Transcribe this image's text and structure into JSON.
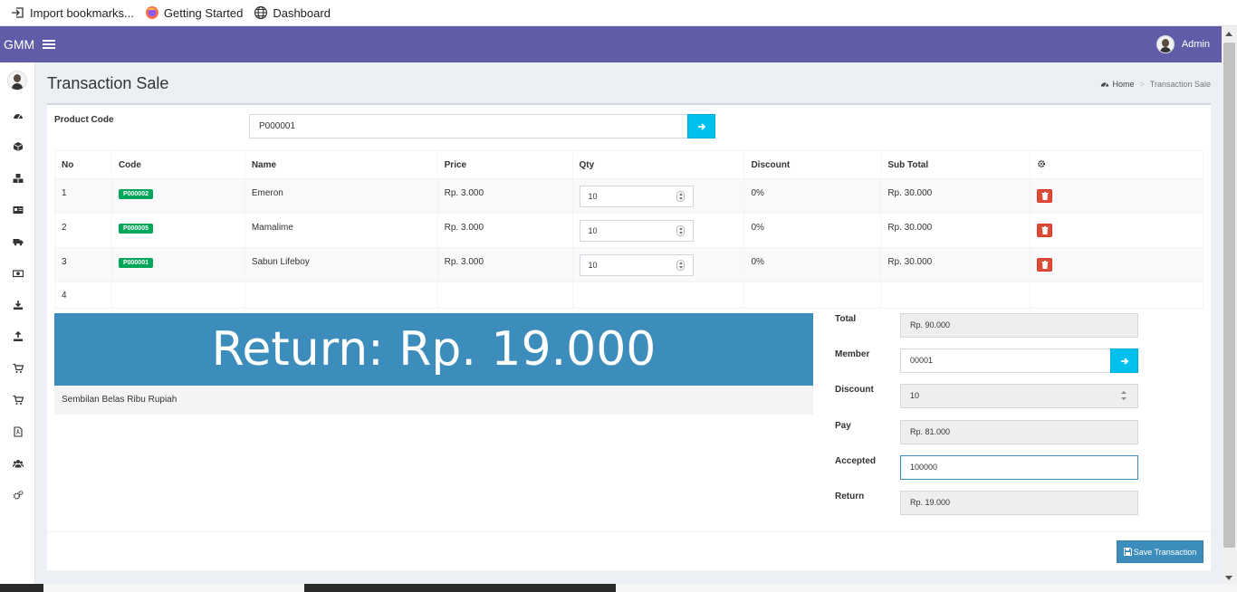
{
  "bookmarks": [
    {
      "label": "Import bookmarks...",
      "icon": "import-icon"
    },
    {
      "label": "Getting Started",
      "icon": "firefox-icon"
    },
    {
      "label": "Dashboard",
      "icon": "globe-icon"
    }
  ],
  "header": {
    "app_name": "GMM",
    "user_name": "Admin"
  },
  "sidebar": {
    "icons": [
      "dashboard-icon",
      "box-icon",
      "cubes-icon",
      "id-card-icon",
      "truck-icon",
      "money-icon",
      "download-icon",
      "upload-icon",
      "cart-icon",
      "cart-icon",
      "pdf-icon",
      "users-icon",
      "cogs-icon"
    ]
  },
  "page": {
    "title": "Transaction Sale",
    "breadcrumb": {
      "home": "Home",
      "separator": ">",
      "current": "Transaction Sale"
    }
  },
  "product": {
    "label": "Product Code",
    "value": "P000001"
  },
  "table": {
    "headers": {
      "no": "No",
      "code": "Code",
      "name": "Name",
      "price": "Price",
      "qty": "Qty",
      "discount": "Discount",
      "subtotal": "Sub Total"
    },
    "rows": [
      {
        "no": "1",
        "code": "P000002",
        "name": "Emeron",
        "price": "Rp. 3.000",
        "qty": "10",
        "discount": "0%",
        "subtotal": "Rp. 30.000"
      },
      {
        "no": "2",
        "code": "P000005",
        "name": "Mamalime",
        "price": "Rp. 3.000",
        "qty": "10",
        "discount": "0%",
        "subtotal": "Rp. 30.000"
      },
      {
        "no": "3",
        "code": "P000001",
        "name": "Sabun Lifeboy",
        "price": "Rp. 3.000",
        "qty": "10",
        "discount": "0%",
        "subtotal": "Rp. 30.000"
      }
    ],
    "empty_row_no": "4"
  },
  "summary": {
    "return_banner": "Return: Rp. 19.000",
    "words": "Sembilan Belas Ribu Rupiah"
  },
  "form": {
    "total": {
      "label": "Total",
      "value": "Rp. 90.000"
    },
    "member": {
      "label": "Member",
      "value": "00001"
    },
    "discount": {
      "label": "Discount",
      "value": "10"
    },
    "pay": {
      "label": "Pay",
      "value": "Rp. 81.000"
    },
    "accepted": {
      "label": "Accepted",
      "value": "100000"
    },
    "return": {
      "label": "Return",
      "value": "Rp. 19.000"
    }
  },
  "actions": {
    "save_label": "Save Transaction"
  },
  "colors": {
    "header": "#605ca8",
    "info": "#00c0ef",
    "primary": "#3c8dbc",
    "success": "#00a65a",
    "danger": "#dd4b39"
  }
}
